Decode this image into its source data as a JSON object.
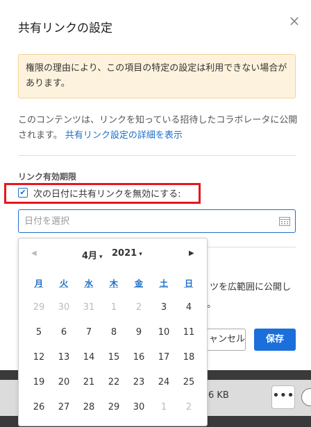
{
  "dialog": {
    "title": "共有リンクの設定",
    "close_icon": "×",
    "warning": "権限の理由により、この項目の特定の設定は利用できない場合があります。",
    "description": "このコンテンツは、リンクを知っている招待したコラボレータに公開されます。",
    "description_link": "共有リンク設定の詳細を表示",
    "section_label": "リンク有効期限",
    "checkbox_label": "次の日付に共有リンクを無効にする:",
    "checkbox_checked": true,
    "date_placeholder": "日付を選択",
    "behind_text_1": "ツを広範囲に公開し",
    "behind_text_2": "。",
    "cancel_label": "ャンセル",
    "save_label": "保存"
  },
  "datepicker": {
    "month": "4月",
    "year": "2021",
    "prev_icon": "◀",
    "next_icon": "▶",
    "weekdays": [
      "月",
      "火",
      "水",
      "木",
      "金",
      "土",
      "日"
    ],
    "days": [
      {
        "label": "29",
        "muted": true
      },
      {
        "label": "30",
        "muted": true
      },
      {
        "label": "31",
        "muted": true
      },
      {
        "label": "1",
        "muted": true
      },
      {
        "label": "2",
        "muted": true
      },
      {
        "label": "3",
        "muted": false
      },
      {
        "label": "4",
        "muted": false
      },
      {
        "label": "5",
        "muted": false
      },
      {
        "label": "6",
        "muted": false
      },
      {
        "label": "7",
        "muted": false
      },
      {
        "label": "8",
        "muted": false
      },
      {
        "label": "9",
        "muted": false
      },
      {
        "label": "10",
        "muted": false
      },
      {
        "label": "11",
        "muted": false
      },
      {
        "label": "12",
        "muted": false
      },
      {
        "label": "13",
        "muted": false
      },
      {
        "label": "14",
        "muted": false
      },
      {
        "label": "15",
        "muted": false
      },
      {
        "label": "16",
        "muted": false
      },
      {
        "label": "17",
        "muted": false
      },
      {
        "label": "18",
        "muted": false
      },
      {
        "label": "19",
        "muted": false
      },
      {
        "label": "20",
        "muted": false
      },
      {
        "label": "21",
        "muted": false
      },
      {
        "label": "22",
        "muted": false
      },
      {
        "label": "23",
        "muted": false
      },
      {
        "label": "24",
        "muted": false
      },
      {
        "label": "25",
        "muted": false
      },
      {
        "label": "26",
        "muted": false
      },
      {
        "label": "27",
        "muted": false
      },
      {
        "label": "28",
        "muted": false
      },
      {
        "label": "29",
        "muted": false
      },
      {
        "label": "30",
        "muted": false
      },
      {
        "label": "1",
        "muted": true
      },
      {
        "label": "2",
        "muted": true
      }
    ]
  },
  "background": {
    "file_size": "6 KB",
    "more_icon": "•••"
  },
  "colors": {
    "accent": "#1a6fc9",
    "primary_button": "#1a6fdb",
    "highlight_border": "#e6161c",
    "warning_bg": "#fdf2dd"
  }
}
